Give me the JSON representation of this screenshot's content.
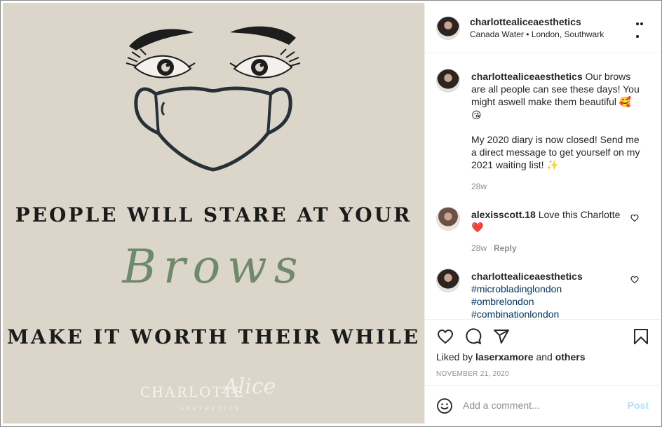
{
  "post_image": {
    "headline_top": "PEOPLE WILL STARE AT YOUR",
    "headline_mid": "Brows",
    "headline_bottom": "MAKE IT WORTH THEIR WHILE",
    "logo_main": "CHARLOTTE",
    "logo_script": "Alice",
    "logo_sub": "AESTHETICS",
    "bg_color": "#dcd6ca",
    "accent_color": "#6f8a6a"
  },
  "header": {
    "username": "charlottealiceaesthetics",
    "location": "Canada Water • London, Southwark",
    "more_icon": "more-horizontal-icon"
  },
  "caption": {
    "username": "charlottealiceaesthetics",
    "text_1": "Our brows are all people can see these days! You might aswell make them beautiful",
    "emoji_1": "🥰",
    "emoji_2": "😘",
    "text_2": "My 2020 diary is now closed! Send me a direct message to get yourself on my 2021 waiting list!",
    "emoji_3": "✨",
    "age": "28w"
  },
  "comment_1": {
    "username": "alexisscott.18",
    "text": "Love this Charlotte",
    "emoji": "❤️",
    "age": "28w",
    "reply": "Reply"
  },
  "comment_2": {
    "username": "charlottealiceaesthetics",
    "hashtags": [
      "#microbladinglondon",
      "#ombrelondon",
      "#combinationlondon"
    ]
  },
  "actions": {
    "liked_prefix": "Liked by",
    "liked_user": "laserxamore",
    "liked_and": "and",
    "liked_others": "others",
    "date": "NOVEMBER 21, 2020"
  },
  "add_comment": {
    "placeholder": "Add a comment...",
    "post_label": "Post"
  }
}
